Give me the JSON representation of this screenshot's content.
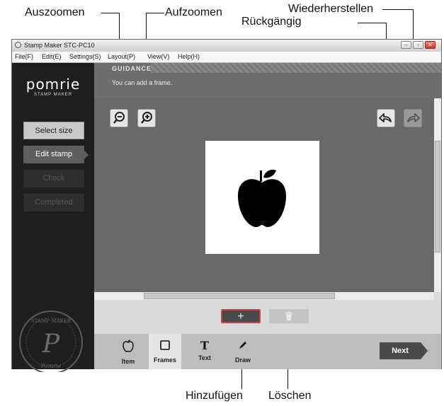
{
  "callouts": {
    "zoom_out": "Auszoomen",
    "zoom_in": "Aufzoomen",
    "redo": "Wiederherstellen",
    "undo": "Rückgängig",
    "add": "Hinzufügen",
    "delete": "Löschen"
  },
  "window": {
    "title": "Stamp Maker STC-PC10",
    "menu": [
      "File(F)",
      "Edit(E)",
      "Settings(S)",
      "Layout(P)",
      "View(V)",
      "Help(H)"
    ]
  },
  "sidebar": {
    "brand": "pomrie",
    "brand_sub": "STAMP MAKER",
    "steps": [
      {
        "label": "Select size",
        "state": "done"
      },
      {
        "label": "Edit stamp",
        "state": "active"
      },
      {
        "label": "Check",
        "state": "disabled"
      },
      {
        "label": "Completed",
        "state": "disabled"
      }
    ],
    "seal": {
      "text_top": "STAMP MAKER",
      "text_bottom": "Pomrie",
      "letter": "P"
    }
  },
  "guidance": {
    "title": "GUIDANCE",
    "message": "You can add a frame."
  },
  "toolpanel": {
    "add_glyph": "+",
    "delete_icon": "trash-icon"
  },
  "tabs": [
    {
      "label": "Item",
      "icon": "apple-icon",
      "glyph": "🍎",
      "selected": false
    },
    {
      "label": "Frames",
      "icon": "frame-icon",
      "glyph": "▢",
      "selected": true
    },
    {
      "label": "Text",
      "icon": "text-icon",
      "glyph": "T",
      "selected": false
    },
    {
      "label": "Draw",
      "icon": "pen-icon",
      "glyph": "✎",
      "selected": false
    }
  ],
  "next_label": "Next",
  "colors": {
    "accent_red": "#c8404a",
    "sidebar_bg": "#1e1e1e",
    "canvas_bg": "#696969"
  }
}
